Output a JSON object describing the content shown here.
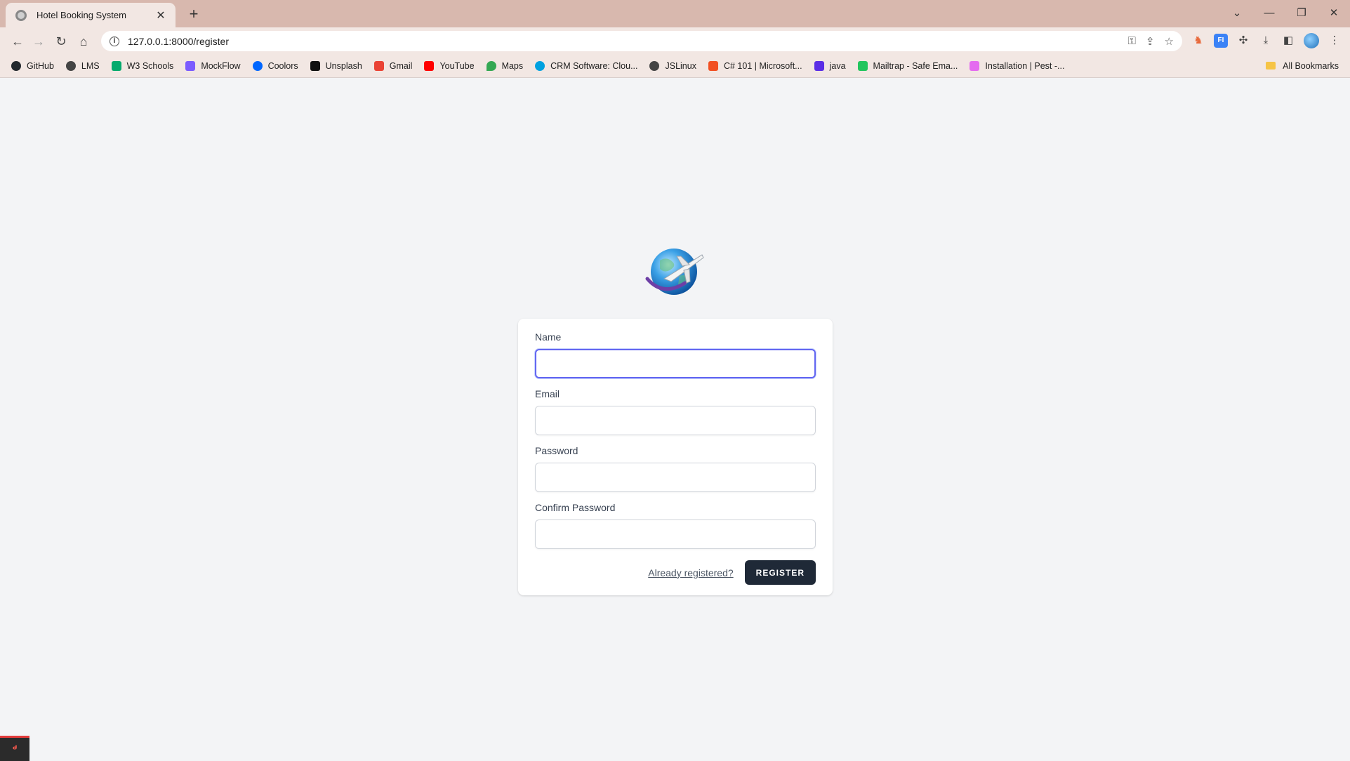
{
  "browser": {
    "tab": {
      "title": "Hotel Booking System"
    },
    "address": {
      "url": "127.0.0.1:8000/register"
    },
    "bookmarks": [
      {
        "label": "GitHub",
        "color": "#24292e"
      },
      {
        "label": "LMS",
        "color": "#444444"
      },
      {
        "label": "W3 Schools",
        "color": "#04aa6d"
      },
      {
        "label": "MockFlow",
        "color": "#7b5cff"
      },
      {
        "label": "Coolors",
        "color": "#0066ff"
      },
      {
        "label": "Unsplash",
        "color": "#111111"
      },
      {
        "label": "Gmail",
        "color": "#ea4335"
      },
      {
        "label": "YouTube",
        "color": "#ff0000"
      },
      {
        "label": "Maps",
        "color": "#34a853"
      },
      {
        "label": "CRM Software: Clou...",
        "color": "#00a1e0"
      },
      {
        "label": "JSLinux",
        "color": "#444444"
      },
      {
        "label": "C# 101 | Microsoft...",
        "color": "#f25022"
      },
      {
        "label": "java",
        "color": "#5b2ee6"
      },
      {
        "label": "Mailtrap - Safe Ema...",
        "color": "#22c55e"
      },
      {
        "label": "Installation | Pest -...",
        "color": "#e46cf0"
      }
    ],
    "all_bookmarks": "All Bookmarks"
  },
  "form": {
    "name_label": "Name",
    "email_label": "Email",
    "password_label": "Password",
    "confirm_label": "Confirm Password",
    "name_value": "",
    "email_value": "",
    "password_value": "",
    "confirm_value": "",
    "login_link": "Already registered?",
    "submit_label": "REGISTER"
  },
  "colors": {
    "accent": "#6366f1",
    "button": "#1f2937",
    "page_bg": "#f3f4f6"
  }
}
